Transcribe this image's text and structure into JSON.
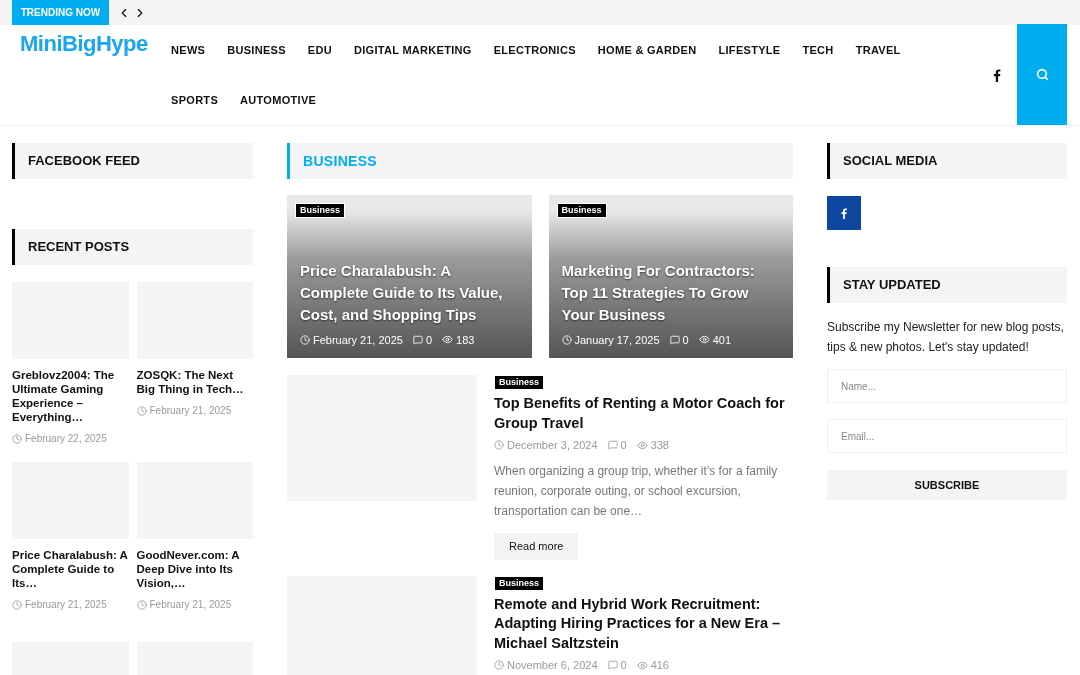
{
  "topbar": {
    "trending_label": "TRENDING NOW"
  },
  "header": {
    "logo": "MiniBigHype",
    "nav": [
      "NEWS",
      "BUSINESS",
      "EDU",
      "DIGITAL MARKETING",
      "ELECTRONICS",
      "HOME & GARDEN",
      "LIFESTYLE",
      "TECH",
      "TRAVEL",
      "SPORTS",
      "AUTOMOTIVE"
    ]
  },
  "left": {
    "facebook_feed_title": "FACEBOOK FEED",
    "recent_posts_title": "RECENT POSTS",
    "recent_posts": [
      {
        "kind": "post",
        "title": "Greblovz2004: The Ultimate Gaming Experience – Everything…",
        "date": "February 22, 2025"
      },
      {
        "kind": "post",
        "title": "ZOSQK: The Next Big Thing in Tech…",
        "date": "February 21, 2025"
      },
      {
        "kind": "post",
        "title": "Price Charalabush: A Complete Guide to Its…",
        "date": "February 21, 2025"
      },
      {
        "kind": "post",
        "title": "GoodNever.com: A Deep Dive into Its Vision,…",
        "date": "February 21, 2025"
      },
      {
        "kind": "image_only"
      },
      {
        "kind": "image_only"
      }
    ]
  },
  "center": {
    "section_title": "BUSINESS",
    "featured": [
      {
        "category": "Business",
        "title": "Price Charalabush: A Complete Guide to Its Value, Cost, and Shopping Tips",
        "date": "February 21, 2025",
        "comments": "0",
        "views": "183"
      },
      {
        "category": "Business",
        "title": "Marketing For Contractors: Top 11 Strategies To Grow Your Business",
        "date": "January 17, 2025",
        "comments": "0",
        "views": "401"
      }
    ],
    "posts": [
      {
        "category": "Business",
        "title": "Top Benefits of Renting a Motor Coach for Group Travel",
        "date": "December 3, 2024",
        "comments": "0",
        "views": "338",
        "excerpt": "When organizing a group trip, whether it’s for a family reunion, corporate outing, or school excursion, transportation can be one…",
        "button": "Read more"
      },
      {
        "category": "Business",
        "title": "Remote and Hybrid Work Recruitment: Adapting Hiring Practices for a New Era – Michael Saltzstein",
        "date": "November 6, 2024",
        "comments": "0",
        "views": "416"
      }
    ]
  },
  "right": {
    "social_title": "SOCIAL MEDIA",
    "social_links": [
      {
        "kind": "facebook"
      }
    ],
    "newsletter": {
      "title": "STAY UPDATED",
      "text": "Subscribe my Newsletter for new blog posts, tips & new photos. Let's stay updated!",
      "name_placeholder": "Name...",
      "email_placeholder": "Email...",
      "button": "SUBSCRIBE"
    }
  }
}
